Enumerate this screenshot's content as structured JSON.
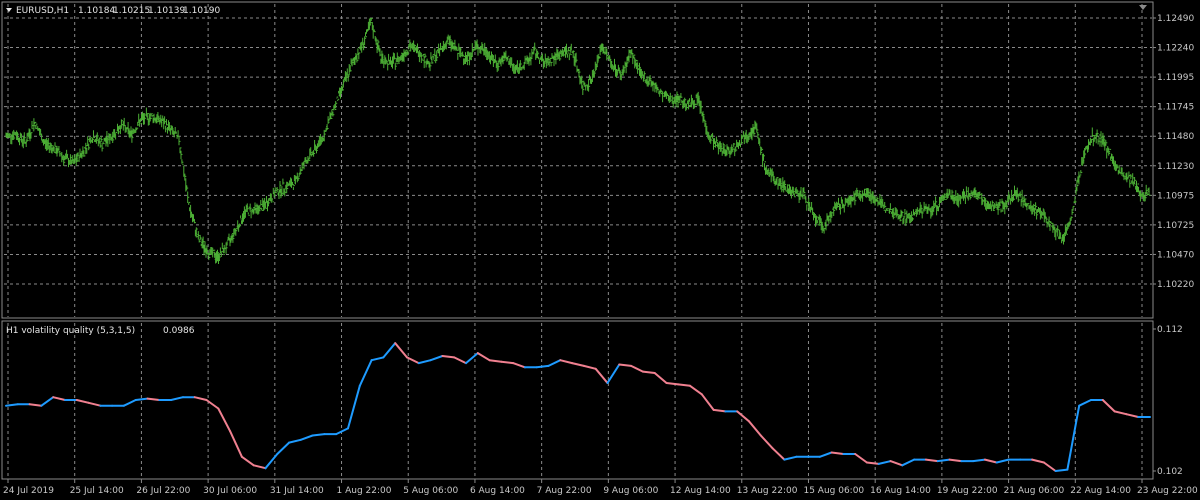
{
  "main_chart": {
    "symbol_timeframe": "EURUSD,H1",
    "ohlc": [
      "1.10184",
      "1.10215",
      "1.10139",
      "1.10190"
    ],
    "dropdown_icon": "triangle-down-icon",
    "price_labels": [
      "1.12490",
      "1.12240",
      "1.11995",
      "1.11745",
      "1.11480",
      "1.11230",
      "1.10975",
      "1.10725",
      "1.10470",
      "1.10220"
    ],
    "bar_color": "#4CAF35"
  },
  "indicator": {
    "title": "H1 volatility quality (5,3,1,5)",
    "value": "0.0986",
    "scale_labels": [
      "0.112",
      "0.102"
    ],
    "up_color": "#1E9BFF",
    "down_color": "#F08090"
  },
  "time_labels": [
    "24 Jul 2019",
    "25 Jul 14:00",
    "26 Jul 22:00",
    "30 Jul 06:00",
    "31 Jul 14:00",
    "1 Aug 22:00",
    "5 Aug 06:00",
    "6 Aug 14:00",
    "7 Aug 22:00",
    "9 Aug 06:00",
    "12 Aug 14:00",
    "13 Aug 22:00",
    "15 Aug 06:00",
    "16 Aug 14:00",
    "19 Aug 22:00",
    "21 Aug 06:00",
    "22 Aug 14:00",
    "23 Aug 22:00"
  ],
  "colors": {
    "background": "#000000",
    "grid": "#8a8a8a",
    "text": "#c8c8c8"
  },
  "chart_data": [
    {
      "type": "bar",
      "title": "EURUSD,H1",
      "ylim": [
        1.1022,
        1.1249
      ],
      "x": [
        "24 Jul 2019",
        "25 Jul 14:00",
        "26 Jul 22:00",
        "30 Jul 06:00",
        "31 Jul 14:00",
        "1 Aug 22:00",
        "5 Aug 06:00",
        "6 Aug 14:00",
        "7 Aug 22:00",
        "9 Aug 06:00",
        "12 Aug 14:00",
        "13 Aug 22:00",
        "15 Aug 06:00",
        "16 Aug 14:00",
        "19 Aug 22:00",
        "21 Aug 06:00",
        "22 Aug 14:00",
        "23 Aug 22:00"
      ],
      "series": [
        {
          "values": [
            1.1148,
            1.115,
            1.1143,
            1.116,
            1.1142,
            1.1138,
            1.113,
            1.1125,
            1.1135,
            1.1148,
            1.1142,
            1.1148,
            1.1158,
            1.115,
            1.1162,
            1.1165,
            1.1162,
            1.1155,
            1.1145,
            1.109,
            1.106,
            1.105,
            1.1045,
            1.1055,
            1.107,
            1.1085,
            1.1085,
            1.109,
            1.11,
            1.1105,
            1.1108,
            1.1125,
            1.1135,
            1.1148,
            1.117,
            1.119,
            1.121,
            1.1225,
            1.1245,
            1.1215,
            1.121,
            1.1215,
            1.1225,
            1.122,
            1.121,
            1.122,
            1.123,
            1.122,
            1.1215,
            1.1225,
            1.122,
            1.121,
            1.1215,
            1.1205,
            1.121,
            1.122,
            1.121,
            1.1215,
            1.122,
            1.122,
            1.119,
            1.1198,
            1.1225,
            1.121,
            1.12,
            1.122,
            1.12,
            1.1195,
            1.1185,
            1.118,
            1.118,
            1.1175,
            1.118,
            1.115,
            1.114,
            1.1135,
            1.114,
            1.115,
            1.1155,
            1.112,
            1.111,
            1.1105,
            1.11,
            1.1098,
            1.108,
            1.107,
            1.1085,
            1.109,
            1.1095,
            1.11,
            1.1098,
            1.109,
            1.1085,
            1.108,
            1.1078,
            1.1085,
            1.1085,
            1.109,
            1.11,
            1.1095,
            1.1098,
            1.1098,
            1.109,
            1.1088,
            1.109,
            1.11,
            1.1092,
            1.1085,
            1.108,
            1.107,
            1.106,
            1.1085,
            1.113,
            1.1148,
            1.1145,
            1.113,
            1.1115,
            1.111,
            1.11,
            1.11
          ]
        }
      ]
    },
    {
      "type": "line",
      "title": "H1 volatility quality (5,3,1,5)",
      "ylim": [
        0.102,
        0.112
      ],
      "x": [
        "24 Jul 2019",
        "25 Jul 14:00",
        "26 Jul 22:00",
        "30 Jul 06:00",
        "31 Jul 14:00",
        "1 Aug 22:00",
        "5 Aug 06:00",
        "6 Aug 14:00",
        "7 Aug 22:00",
        "9 Aug 06:00",
        "12 Aug 14:00",
        "13 Aug 22:00",
        "15 Aug 06:00",
        "16 Aug 14:00",
        "19 Aug 22:00",
        "21 Aug 06:00",
        "22 Aug 14:00",
        "23 Aug 22:00"
      ],
      "series": [
        {
          "values": [
            0.1066,
            0.1067,
            0.1067,
            0.1066,
            0.1072,
            0.107,
            0.107,
            0.1068,
            0.1066,
            0.1066,
            0.1066,
            0.107,
            0.1071,
            0.107,
            0.107,
            0.1072,
            0.1072,
            0.107,
            0.1064,
            0.1048,
            0.103,
            0.1024,
            0.1022,
            0.1032,
            0.104,
            0.1042,
            0.1045,
            0.1046,
            0.1046,
            0.105,
            0.108,
            0.1098,
            0.11,
            0.111,
            0.11,
            0.1096,
            0.1098,
            0.1101,
            0.11,
            0.1096,
            0.1103,
            0.1098,
            0.1097,
            0.1096,
            0.1093,
            0.1093,
            0.1094,
            0.1098,
            0.1096,
            0.1094,
            0.1092,
            0.1082,
            0.1095,
            0.1094,
            0.109,
            0.1089,
            0.1082,
            0.1081,
            0.108,
            0.1074,
            0.1063,
            0.1062,
            0.1062,
            0.1055,
            0.1045,
            0.1036,
            0.1028,
            0.103,
            0.103,
            0.103,
            0.1033,
            0.1032,
            0.1032,
            0.1026,
            0.1025,
            0.1027,
            0.1024,
            0.1028,
            0.1028,
            0.1027,
            0.1028,
            0.1027,
            0.1027,
            0.1028,
            0.1026,
            0.1028,
            0.1028,
            0.1028,
            0.1026,
            0.102,
            0.1021,
            0.1066,
            0.107,
            0.107,
            0.1062,
            0.106,
            0.1058,
            0.1058
          ]
        }
      ]
    }
  ]
}
